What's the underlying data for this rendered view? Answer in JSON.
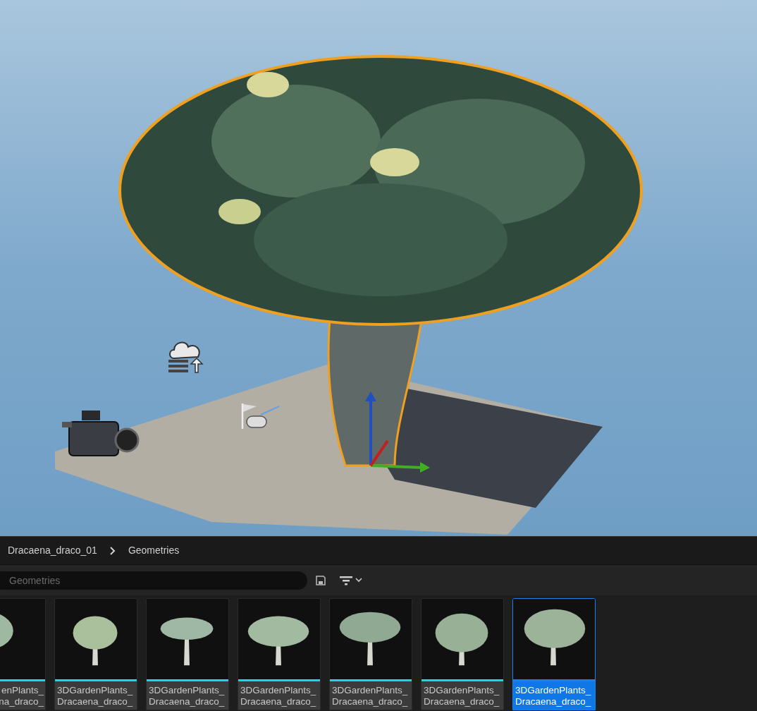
{
  "breadcrumb": {
    "items": [
      "Dracaena_draco_01",
      "Geometries"
    ]
  },
  "search": {
    "placeholder": "Geometries"
  },
  "assets": [
    {
      "lines": [
        "enPlants_",
        "na_draco_"
      ],
      "selected": false
    },
    {
      "lines": [
        "3DGardenPlants_",
        "Dracaena_draco_"
      ],
      "selected": false
    },
    {
      "lines": [
        "3DGardenPlants_",
        "Dracaena_draco_"
      ],
      "selected": false
    },
    {
      "lines": [
        "3DGardenPlants_",
        "Dracaena_draco_"
      ],
      "selected": false
    },
    {
      "lines": [
        "3DGardenPlants_",
        "Dracaena_draco_"
      ],
      "selected": false
    },
    {
      "lines": [
        "3DGardenPlants_",
        "Dracaena_draco_"
      ],
      "selected": false
    },
    {
      "lines": [
        "3DGardenPlants_",
        "Dracaena_draco_"
      ],
      "selected": true
    }
  ]
}
